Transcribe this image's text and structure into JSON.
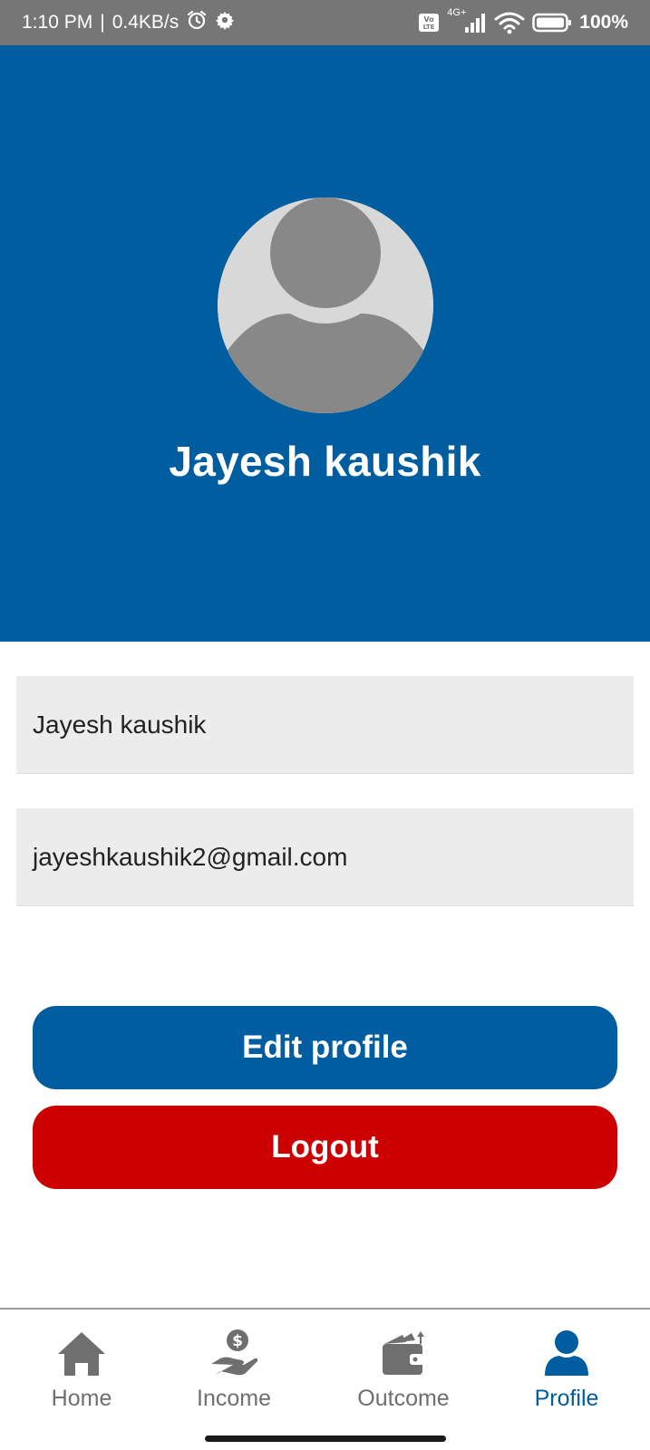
{
  "status_bar": {
    "time": "1:10 PM",
    "speed": "0.4KB/s",
    "network": "4G+",
    "battery": "100%",
    "icons": [
      "alarm-icon",
      "gear-icon",
      "volte-icon",
      "signal-icon",
      "wifi-icon",
      "battery-icon"
    ]
  },
  "profile": {
    "display_name": "Jayesh kaushik",
    "avatar_icon": "default-user-avatar"
  },
  "fields": {
    "name_value": "Jayesh kaushik",
    "email_value": "jayeshkaushik2@gmail.com"
  },
  "actions": {
    "edit_label": "Edit profile",
    "logout_label": "Logout"
  },
  "nav": {
    "items": [
      {
        "label": "Home",
        "icon": "home-icon"
      },
      {
        "label": "Income",
        "icon": "income-icon"
      },
      {
        "label": "Outcome",
        "icon": "wallet-icon"
      },
      {
        "label": "Profile",
        "icon": "user-icon"
      }
    ],
    "active": "Profile"
  },
  "colors": {
    "brand_blue": "#005da0",
    "danger_red": "#cc0000",
    "status_bar_gray": "#767676",
    "field_gray": "#ececec"
  }
}
